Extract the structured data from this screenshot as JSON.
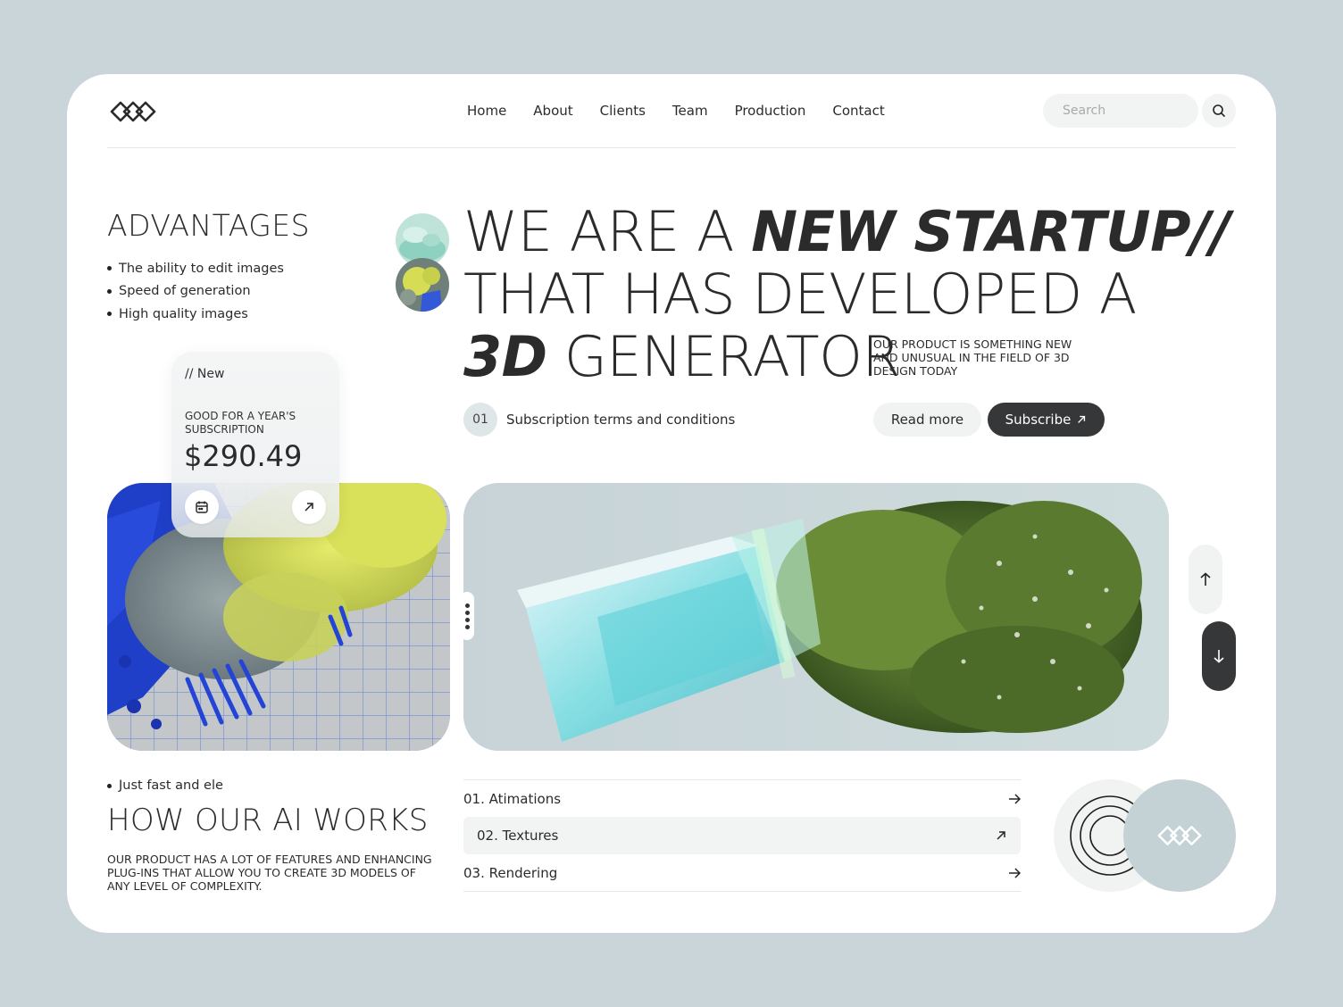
{
  "header": {
    "logo_name": "infinity-rings-logo",
    "nav": [
      "Home",
      "About",
      "Clients",
      "Team",
      "Production",
      "Contact"
    ],
    "search_placeholder": "Search"
  },
  "advantages": {
    "title": "ADVANTAGES",
    "items": [
      "The ability to edit images",
      "Speed of generation",
      "High quality images"
    ]
  },
  "price_card": {
    "tag": "// New",
    "label": "GOOD FOR A YEAR'S SUBSCRIPTION",
    "price": "$290.49"
  },
  "hero": {
    "line1_plain": "WE ARE A ",
    "line1_italic": "NEW STARTUP//",
    "line2": "THAT HAS DEVELOPED A",
    "line3_italic": "3D",
    "line3_plain": " GENERATOR",
    "note": "OUR PRODUCT IS SOMETHING NEW AND UNUSUAL IN THE FIELD OF 3D DESIGN TODAY"
  },
  "subscription": {
    "number": "01",
    "terms": "Subscription terms and conditions",
    "read_more": "Read more",
    "subscribe": "Subscribe"
  },
  "how": {
    "bullet": "Just fast and ele",
    "title": "HOW OUR AI WORKS",
    "description": "OUR PRODUCT HAS A LOT OF FEATURES AND ENHANCING PLUG-INS THAT ALLOW YOU TO CREATE 3D MODELS OF ANY LEVEL OF COMPLEXITY."
  },
  "features": [
    {
      "label": "01. Atimations",
      "icon": "arrow-right-icon",
      "active": false
    },
    {
      "label": "02. Textures",
      "icon": "arrow-up-right-icon",
      "active": true
    },
    {
      "label": "03. Rendering",
      "icon": "arrow-right-icon",
      "active": false
    }
  ],
  "colors": {
    "background": "#c9d5d8",
    "card": "#ffffff",
    "dark": "#353738",
    "accent_blue_grey": "#c5d2d5",
    "light_grey": "#f1f2f2"
  }
}
